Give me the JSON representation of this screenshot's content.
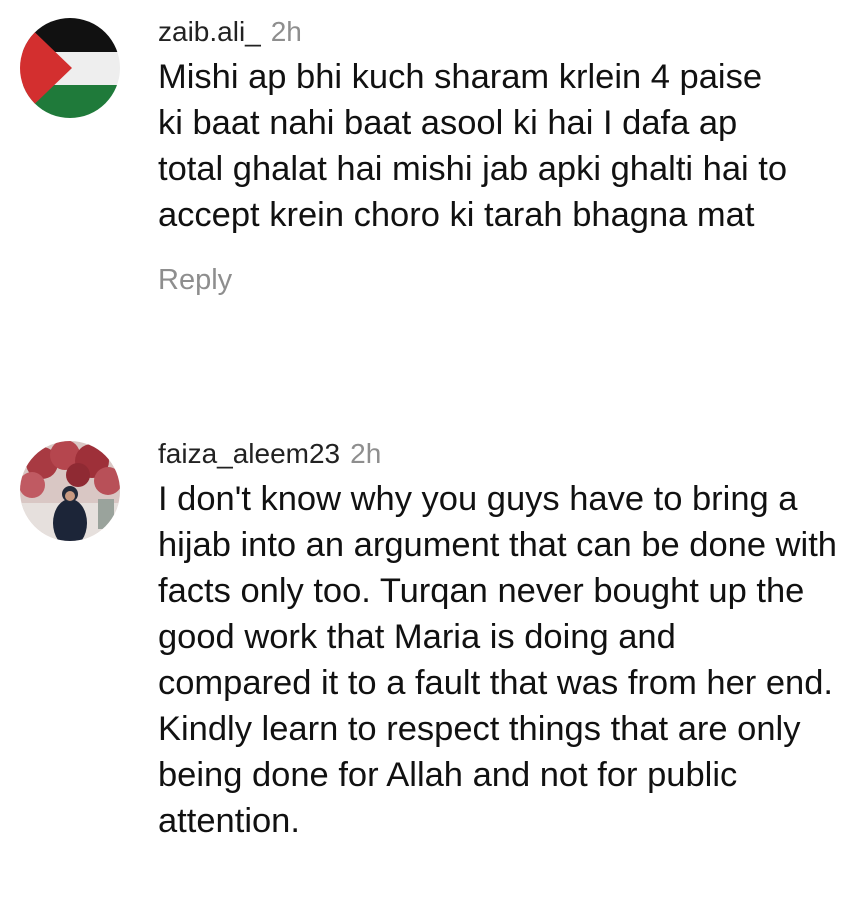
{
  "comments": [
    {
      "username": "zaib.ali_",
      "time": "2h",
      "text": "Mishi ap bhi kuch sharam krlein 4 paise ki baat nahi baat asool ki hai I dafa ap total ghalat hai mishi jab apki ghalti hai to accept krein choro ki tarah bhagna mat",
      "reply_label": "Reply",
      "avatar": "palestine-flag-avatar"
    },
    {
      "username": "faiza_aleem23",
      "time": "2h",
      "text": "I don't know why you guys have to bring a hijab into an argument that can be done with facts only too. Turqan never bought up the good work that Maria is doing and compared it to a fault that was from her end. Kindly learn to respect things that are only being done for Allah and not for public attention.",
      "avatar": "profile-photo-avatar"
    }
  ],
  "colors": {
    "flag_black": "#111111",
    "flag_white": "#eeeeee",
    "flag_green": "#1f7a3a",
    "flag_red": "#d32f2f",
    "muted_text": "#8e8e8e"
  }
}
